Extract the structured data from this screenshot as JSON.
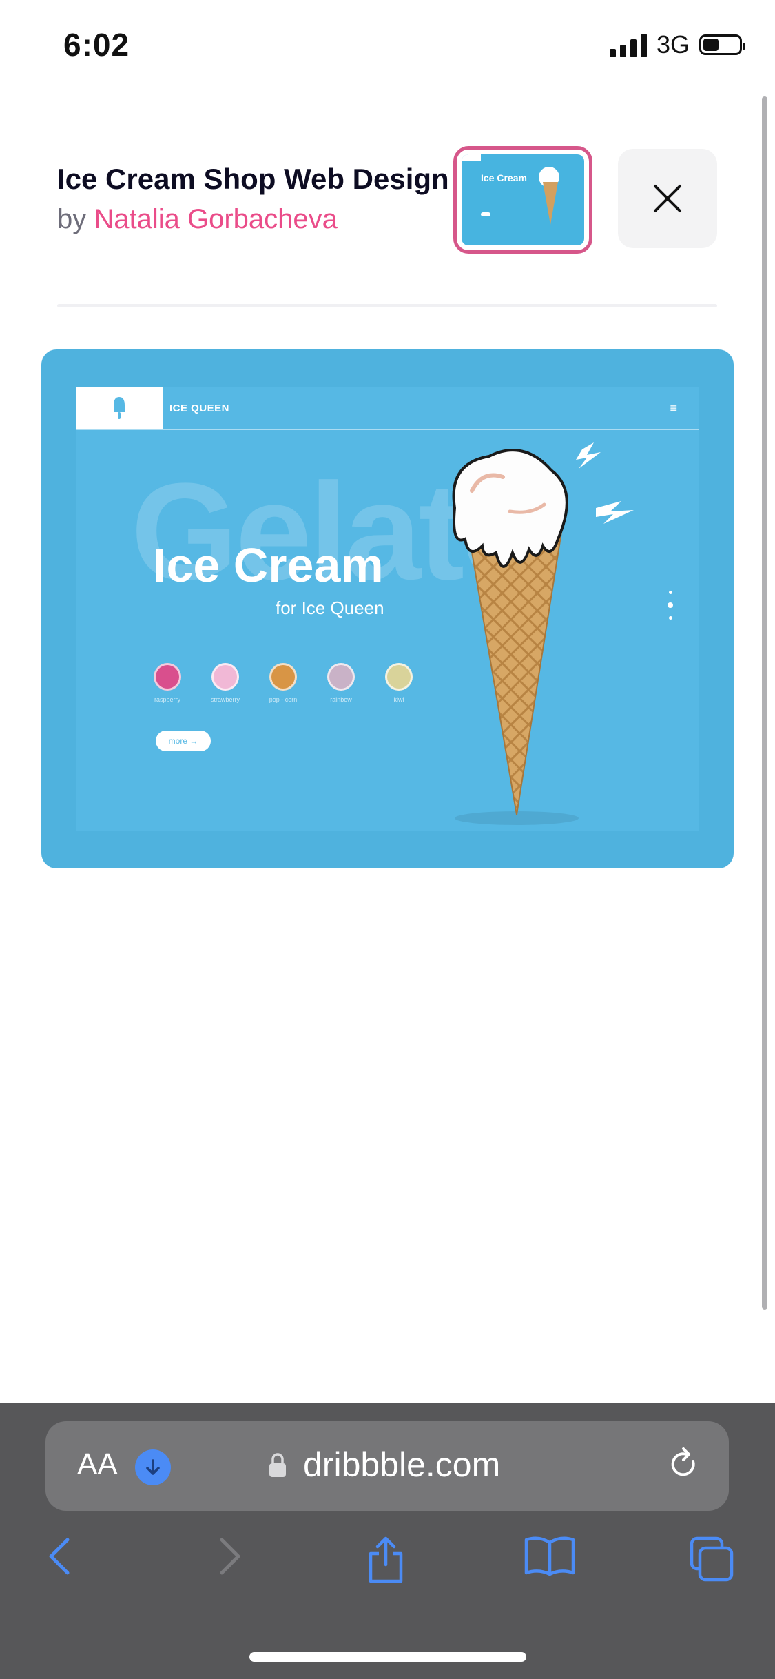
{
  "status_bar": {
    "time": "6:02",
    "network": "3G",
    "battery_level": 0.35
  },
  "header": {
    "title": "Ice Cream Shop Web Design",
    "by_prefix": "by",
    "author": "Natalia Gorbacheva",
    "close_icon": "close-icon"
  },
  "shot": {
    "brand": "ICE QUEEN",
    "menu_icon": "≡",
    "background_word": "Gelato",
    "headline": "Ice Cream",
    "subheadline": "for Ice Queen",
    "flavors": [
      {
        "label": "raspberry",
        "color": "#d94f8d"
      },
      {
        "label": "strawberry",
        "color": "#f1b8d6"
      },
      {
        "label": "pop - corn",
        "color": "#d89545"
      },
      {
        "label": "rainbow",
        "color": "#c9b2c7"
      },
      {
        "label": "kiwi",
        "color": "#d9d39a"
      }
    ],
    "more_button": "more →"
  },
  "browser": {
    "text_size_label": "AA",
    "url": "dribbble.com",
    "toolbar": [
      "back-icon",
      "forward-icon",
      "share-icon",
      "bookmarks-icon",
      "tabs-icon"
    ]
  },
  "colors": {
    "accent_pink": "#ea4c89",
    "shot_blue": "#4fb2de",
    "safari_blue": "#4b8bf5"
  }
}
